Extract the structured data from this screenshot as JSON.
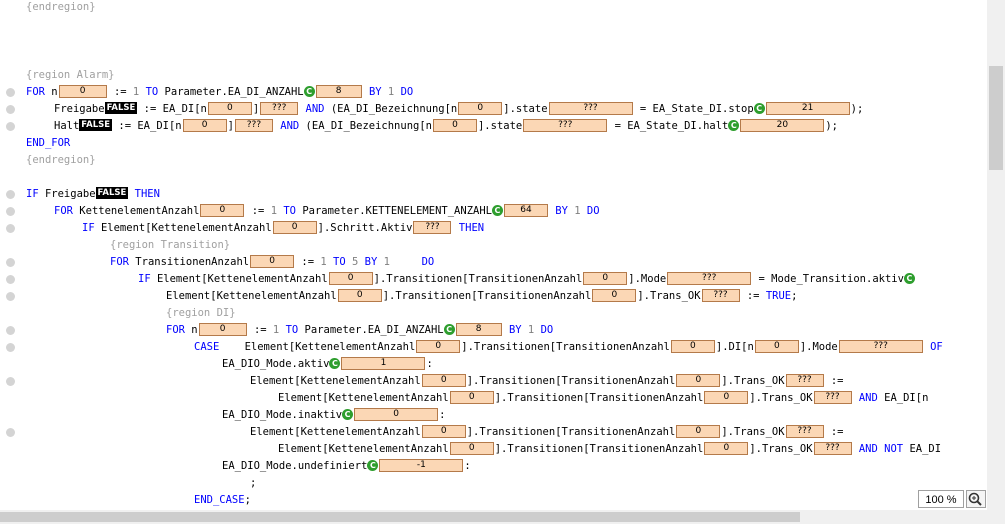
{
  "editor": {
    "lines": [
      {
        "bp": false,
        "indent": 0,
        "tokens": [
          {
            "k": "cm",
            "t": "{endregion}"
          }
        ]
      },
      {
        "bp": false,
        "indent": 0,
        "tokens": []
      },
      {
        "bp": false,
        "indent": 0,
        "tokens": []
      },
      {
        "bp": false,
        "indent": 0,
        "tokens": []
      },
      {
        "bp": false,
        "indent": 0,
        "tokens": [
          {
            "k": "cm",
            "t": "{region Alarm}"
          }
        ]
      },
      {
        "bp": true,
        "indent": 0,
        "tokens": [
          {
            "k": "kw",
            "t": "FOR "
          },
          {
            "k": "tx",
            "t": "n"
          },
          {
            "k": "val",
            "t": "0",
            "w": 48
          },
          {
            "k": "tx",
            "t": " := "
          },
          {
            "k": "num",
            "t": "1"
          },
          {
            "k": "kw",
            "t": " TO "
          },
          {
            "k": "tx",
            "t": "Parameter.EA_DI_ANZAHL"
          },
          {
            "k": "cc"
          },
          {
            "k": "val",
            "t": "8",
            "w": 46
          },
          {
            "k": "kw",
            "t": " BY "
          },
          {
            "k": "num",
            "t": "1"
          },
          {
            "k": "kw",
            "t": " DO"
          }
        ]
      },
      {
        "bp": true,
        "indent": 1,
        "tokens": [
          {
            "k": "tx",
            "t": "Freigabe"
          },
          {
            "k": "bool",
            "t": "FALSE"
          },
          {
            "k": "tx",
            "t": " := EA_DI[n"
          },
          {
            "k": "val",
            "t": "0",
            "w": 44
          },
          {
            "k": "tx",
            "t": "]"
          },
          {
            "k": "val",
            "t": "???",
            "w": 38
          },
          {
            "k": "kw",
            "t": " AND "
          },
          {
            "k": "tx",
            "t": "(EA_DI_Bezeichnung[n"
          },
          {
            "k": "val",
            "t": "0",
            "w": 44
          },
          {
            "k": "tx",
            "t": "].state"
          },
          {
            "k": "val",
            "t": "???",
            "w": 84
          },
          {
            "k": "tx",
            "t": " = EA_State_DI.stop"
          },
          {
            "k": "cc"
          },
          {
            "k": "val",
            "t": "21",
            "w": 84
          },
          {
            "k": "tx",
            "t": ");"
          }
        ]
      },
      {
        "bp": true,
        "indent": 1,
        "tokens": [
          {
            "k": "tx",
            "t": "Halt"
          },
          {
            "k": "bool",
            "t": "FALSE"
          },
          {
            "k": "tx",
            "t": " := EA_DI[n"
          },
          {
            "k": "val",
            "t": "0",
            "w": 44
          },
          {
            "k": "tx",
            "t": "]"
          },
          {
            "k": "val",
            "t": "???",
            "w": 38
          },
          {
            "k": "kw",
            "t": " AND "
          },
          {
            "k": "tx",
            "t": "(EA_DI_Bezeichnung[n"
          },
          {
            "k": "val",
            "t": "0",
            "w": 44
          },
          {
            "k": "tx",
            "t": "].state"
          },
          {
            "k": "val",
            "t": "???",
            "w": 84
          },
          {
            "k": "tx",
            "t": " = EA_State_DI.halt"
          },
          {
            "k": "cc"
          },
          {
            "k": "val",
            "t": "20",
            "w": 84
          },
          {
            "k": "tx",
            "t": ");"
          }
        ]
      },
      {
        "bp": false,
        "indent": 0,
        "tokens": [
          {
            "k": "kw",
            "t": "END_FOR"
          }
        ]
      },
      {
        "bp": false,
        "indent": 0,
        "tokens": [
          {
            "k": "cm",
            "t": "{endregion}"
          }
        ]
      },
      {
        "bp": false,
        "indent": 0,
        "tokens": []
      },
      {
        "bp": true,
        "indent": 0,
        "tokens": [
          {
            "k": "kw",
            "t": "IF "
          },
          {
            "k": "tx",
            "t": "Freigabe"
          },
          {
            "k": "bool",
            "t": "FALSE"
          },
          {
            "k": "kw",
            "t": " THEN"
          }
        ]
      },
      {
        "bp": true,
        "indent": 1,
        "tokens": [
          {
            "k": "kw",
            "t": "FOR "
          },
          {
            "k": "tx",
            "t": "KettenelementAnzahl"
          },
          {
            "k": "val",
            "t": "0",
            "w": 44
          },
          {
            "k": "tx",
            "t": " := "
          },
          {
            "k": "num",
            "t": "1"
          },
          {
            "k": "kw",
            "t": " TO "
          },
          {
            "k": "tx",
            "t": "Parameter.KETTENELEMENT_ANZAHL"
          },
          {
            "k": "cc"
          },
          {
            "k": "val",
            "t": "64",
            "w": 44
          },
          {
            "k": "kw",
            "t": " BY "
          },
          {
            "k": "num",
            "t": "1"
          },
          {
            "k": "kw",
            "t": " DO"
          }
        ]
      },
      {
        "bp": true,
        "indent": 2,
        "tokens": [
          {
            "k": "kw",
            "t": "IF "
          },
          {
            "k": "tx",
            "t": "Element[KettenelementAnzahl"
          },
          {
            "k": "val",
            "t": "0",
            "w": 44
          },
          {
            "k": "tx",
            "t": "].Schritt.Aktiv"
          },
          {
            "k": "val",
            "t": "???",
            "w": 38
          },
          {
            "k": "kw",
            "t": " THEN"
          }
        ]
      },
      {
        "bp": false,
        "indent": 3,
        "tokens": [
          {
            "k": "cm",
            "t": "{region Transition}"
          }
        ]
      },
      {
        "bp": true,
        "indent": 3,
        "tokens": [
          {
            "k": "kw",
            "t": "FOR "
          },
          {
            "k": "tx",
            "t": "TransitionenAnzahl"
          },
          {
            "k": "val",
            "t": "0",
            "w": 44
          },
          {
            "k": "tx",
            "t": " := "
          },
          {
            "k": "num",
            "t": "1"
          },
          {
            "k": "kw",
            "t": " TO "
          },
          {
            "k": "num",
            "t": "5"
          },
          {
            "k": "kw",
            "t": " BY "
          },
          {
            "k": "num",
            "t": "1"
          },
          {
            "k": "kw",
            "t": "     DO"
          }
        ]
      },
      {
        "bp": true,
        "indent": 4,
        "tokens": [
          {
            "k": "kw",
            "t": "IF "
          },
          {
            "k": "tx",
            "t": "Element[KettenelementAnzahl"
          },
          {
            "k": "val",
            "t": "0",
            "w": 44
          },
          {
            "k": "tx",
            "t": "].Transitionen[TransitionenAnzahl"
          },
          {
            "k": "val",
            "t": "0",
            "w": 44
          },
          {
            "k": "tx",
            "t": "].Mode"
          },
          {
            "k": "val",
            "t": "???",
            "w": 84
          },
          {
            "k": "tx",
            "t": " = Mode_Transition.aktiv"
          },
          {
            "k": "cc"
          }
        ]
      },
      {
        "bp": true,
        "indent": 5,
        "tokens": [
          {
            "k": "tx",
            "t": "Element[KettenelementAnzahl"
          },
          {
            "k": "val",
            "t": "0",
            "w": 44
          },
          {
            "k": "tx",
            "t": "].Transitionen[TransitionenAnzahl"
          },
          {
            "k": "val",
            "t": "0",
            "w": 44
          },
          {
            "k": "tx",
            "t": "].Trans_OK"
          },
          {
            "k": "val",
            "t": "???",
            "w": 38
          },
          {
            "k": "tx",
            "t": " := "
          },
          {
            "k": "kw",
            "t": "TRUE"
          },
          {
            "k": "tx",
            "t": ";"
          }
        ]
      },
      {
        "bp": false,
        "indent": 5,
        "tokens": [
          {
            "k": "cm",
            "t": "{region DI}"
          }
        ]
      },
      {
        "bp": true,
        "indent": 5,
        "tokens": [
          {
            "k": "kw",
            "t": "FOR "
          },
          {
            "k": "tx",
            "t": "n"
          },
          {
            "k": "val",
            "t": "0",
            "w": 48
          },
          {
            "k": "tx",
            "t": " := "
          },
          {
            "k": "num",
            "t": "1"
          },
          {
            "k": "kw",
            "t": " TO "
          },
          {
            "k": "tx",
            "t": "Parameter.EA_DI_ANZAHL"
          },
          {
            "k": "cc"
          },
          {
            "k": "val",
            "t": "8",
            "w": 46
          },
          {
            "k": "kw",
            "t": " BY "
          },
          {
            "k": "num",
            "t": "1"
          },
          {
            "k": "kw",
            "t": " DO"
          }
        ]
      },
      {
        "bp": true,
        "indent": 6,
        "tokens": [
          {
            "k": "kw",
            "t": "CASE"
          },
          {
            "k": "tx",
            "t": "    Element[KettenelementAnzahl"
          },
          {
            "k": "val",
            "t": "0",
            "w": 44
          },
          {
            "k": "tx",
            "t": "].Transitionen[TransitionenAnzahl"
          },
          {
            "k": "val",
            "t": "0",
            "w": 44
          },
          {
            "k": "tx",
            "t": "].DI[n"
          },
          {
            "k": "val",
            "t": "0",
            "w": 44
          },
          {
            "k": "tx",
            "t": "].Mode"
          },
          {
            "k": "val",
            "t": "???",
            "w": 84
          },
          {
            "k": "kw",
            "t": " OF"
          }
        ]
      },
      {
        "bp": false,
        "indent": 7,
        "tokens": [
          {
            "k": "tx",
            "t": "EA_DIO_Mode.aktiv"
          },
          {
            "k": "cc"
          },
          {
            "k": "val",
            "t": "1",
            "w": 84
          },
          {
            "k": "tx",
            "t": ":"
          }
        ]
      },
      {
        "bp": true,
        "indent": 8,
        "tokens": [
          {
            "k": "tx",
            "t": "Element[KettenelementAnzahl"
          },
          {
            "k": "val",
            "t": "0",
            "w": 44
          },
          {
            "k": "tx",
            "t": "].Transitionen[TransitionenAnzahl"
          },
          {
            "k": "val",
            "t": "0",
            "w": 44
          },
          {
            "k": "tx",
            "t": "].Trans_OK"
          },
          {
            "k": "val",
            "t": "???",
            "w": 38
          },
          {
            "k": "tx",
            "t": " :="
          }
        ]
      },
      {
        "bp": false,
        "indent": 9,
        "tokens": [
          {
            "k": "tx",
            "t": "Element[KettenelementAnzahl"
          },
          {
            "k": "val",
            "t": "0",
            "w": 44
          },
          {
            "k": "tx",
            "t": "].Transitionen[TransitionenAnzahl"
          },
          {
            "k": "val",
            "t": "0",
            "w": 44
          },
          {
            "k": "tx",
            "t": "].Trans_OK"
          },
          {
            "k": "val",
            "t": "???",
            "w": 38
          },
          {
            "k": "kw",
            "t": " AND "
          },
          {
            "k": "tx",
            "t": "EA_DI[n"
          }
        ]
      },
      {
        "bp": false,
        "indent": 7,
        "tokens": [
          {
            "k": "tx",
            "t": "EA_DIO_Mode.inaktiv"
          },
          {
            "k": "cc"
          },
          {
            "k": "val",
            "t": "0",
            "w": 84
          },
          {
            "k": "tx",
            "t": ":"
          }
        ]
      },
      {
        "bp": true,
        "indent": 8,
        "tokens": [
          {
            "k": "tx",
            "t": "Element[KettenelementAnzahl"
          },
          {
            "k": "val",
            "t": "0",
            "w": 44
          },
          {
            "k": "tx",
            "t": "].Transitionen[TransitionenAnzahl"
          },
          {
            "k": "val",
            "t": "0",
            "w": 44
          },
          {
            "k": "tx",
            "t": "].Trans_OK"
          },
          {
            "k": "val",
            "t": "???",
            "w": 38
          },
          {
            "k": "tx",
            "t": " :="
          }
        ]
      },
      {
        "bp": false,
        "indent": 9,
        "tokens": [
          {
            "k": "tx",
            "t": "Element[KettenelementAnzahl"
          },
          {
            "k": "val",
            "t": "0",
            "w": 44
          },
          {
            "k": "tx",
            "t": "].Transitionen[TransitionenAnzahl"
          },
          {
            "k": "val",
            "t": "0",
            "w": 44
          },
          {
            "k": "tx",
            "t": "].Trans_OK"
          },
          {
            "k": "val",
            "t": "???",
            "w": 38
          },
          {
            "k": "kw",
            "t": " AND NOT "
          },
          {
            "k": "tx",
            "t": "EA_DI"
          }
        ]
      },
      {
        "bp": false,
        "indent": 7,
        "tokens": [
          {
            "k": "tx",
            "t": "EA_DIO_Mode.undefiniert"
          },
          {
            "k": "cc"
          },
          {
            "k": "val",
            "t": "-1",
            "w": 84
          },
          {
            "k": "tx",
            "t": ":"
          }
        ]
      },
      {
        "bp": false,
        "indent": 8,
        "tokens": [
          {
            "k": "tx",
            "t": ";"
          }
        ]
      },
      {
        "bp": false,
        "indent": 6,
        "tokens": [
          {
            "k": "kw",
            "t": "END_CASE"
          },
          {
            "k": "tx",
            "t": ";"
          }
        ]
      }
    ]
  },
  "statusbar": {
    "zoom": "100 %"
  },
  "icons": {
    "zoom_button": "magnifier-icon",
    "breakpoint": "breakpoint-dot-icon",
    "constant_marker": "constant-marker-icon"
  },
  "colors": {
    "keyword": "#0000ff",
    "comment": "#a0a0a0",
    "value_box": "#fbd7b5",
    "constant_marker": "#2e9e2e"
  }
}
